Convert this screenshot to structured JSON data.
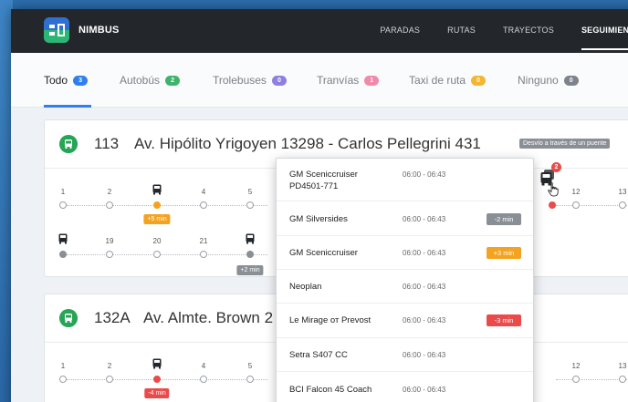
{
  "app": {
    "brand": "NIMBUS"
  },
  "nav": [
    {
      "label": "PARADAS",
      "active": false
    },
    {
      "label": "RUTAS",
      "active": false
    },
    {
      "label": "TRAYECTOS",
      "active": false
    },
    {
      "label": "SEGUIMIENTO",
      "active": true
    }
  ],
  "filters": [
    {
      "label": "Todo",
      "count": "3",
      "color": "#2f80ed",
      "active": true
    },
    {
      "label": "Autobús",
      "count": "2",
      "color": "#3db36c",
      "active": false
    },
    {
      "label": "Trolebuses",
      "count": "0",
      "color": "#8f80e0",
      "active": false
    },
    {
      "label": "Tranvías",
      "count": "1",
      "color": "#f08aa8",
      "active": false
    },
    {
      "label": "Taxi de ruta",
      "count": "0",
      "color": "#f4b630",
      "active": false
    },
    {
      "label": "Ninguno",
      "count": "0",
      "color": "#7d838a",
      "active": false
    }
  ],
  "routes": [
    {
      "number": "113",
      "name": "Av. Hipólito Yrigoyen 13298 - Carlos Pellegrini 431",
      "badge": "Desvío a través de un puente",
      "row1_stops": [
        "1",
        "2",
        "",
        "4",
        "5"
      ],
      "row1_stops_right": [
        "12",
        "13"
      ],
      "row1_delay": "+5 min",
      "row2_stops": [
        "",
        "19",
        "20",
        "21",
        ""
      ],
      "row2_delay": "+2 min",
      "bus_group_count": "2"
    },
    {
      "number": "132A",
      "name": "Av. Almte. Brown 2",
      "row1_stops": [
        "1",
        "2",
        "",
        "4",
        "5"
      ],
      "row1_stops_right": [
        "12",
        "13"
      ],
      "row1_delay": "-4 min"
    }
  ],
  "popover": {
    "rows": [
      {
        "name": "GM Sceniccruiser PD4501-771",
        "time": "06:00 - 06:43",
        "tag": ""
      },
      {
        "name": "GM Silversides",
        "time": "06:00 - 06:43",
        "tag": "-2 min",
        "tag_color": "#8a8f96"
      },
      {
        "name": "GM Sceniccruiser",
        "time": "06:00 - 06:43",
        "tag": "+3 min",
        "tag_color": "#f4a321"
      },
      {
        "name": "Neoplan",
        "time": "06:00 - 06:43",
        "tag": ""
      },
      {
        "name": "Le Mirage от Prevost",
        "time": "06:00 - 06:43",
        "tag": "-3 min",
        "tag_color": "#ea4a4a"
      },
      {
        "name": "Setra S407 CC",
        "time": "06:00 - 06:43",
        "tag": ""
      },
      {
        "name": "BCI Falcon 45 Coach",
        "time": "06:00 - 06:43",
        "tag": ""
      }
    ]
  },
  "icons": {
    "logo": "nimbus-logo-icon",
    "route": "bus-route-icon",
    "bus": "bus-icon",
    "cursor": "hand-pointer-icon"
  }
}
